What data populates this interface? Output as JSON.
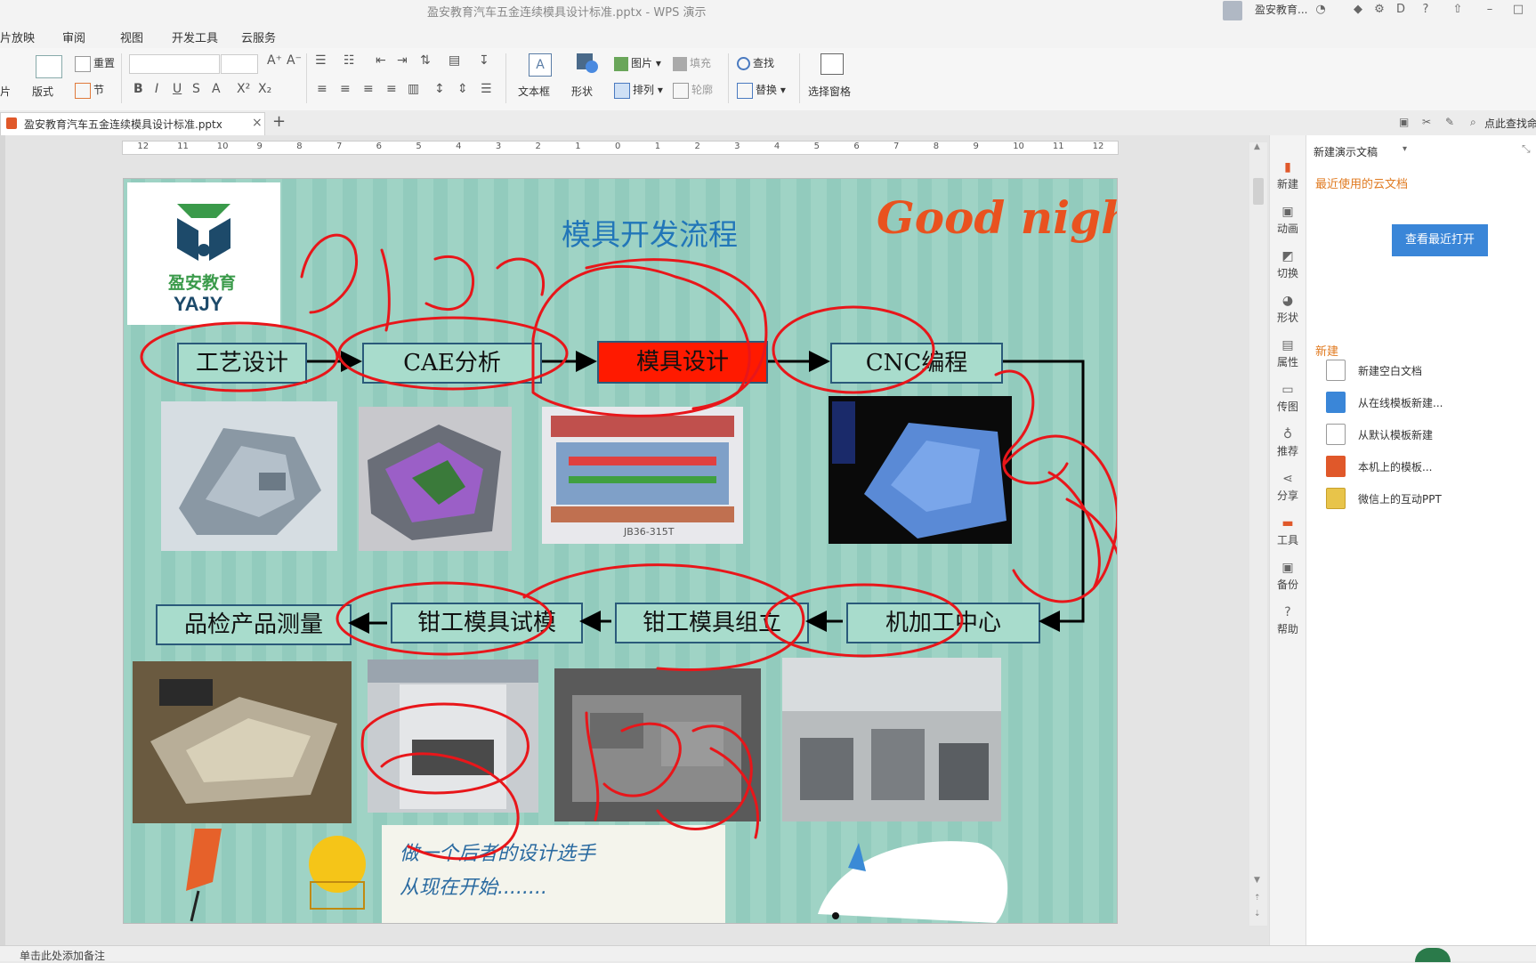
{
  "window": {
    "title": "盈安教育汽车五金连续模具设计标准.pptx - WPS 演示",
    "user": "盈安教育...",
    "help": "?"
  },
  "menu": [
    "片放映",
    "审阅",
    "视图",
    "开发工具",
    "云服务"
  ],
  "ribbon": {
    "slide_label": "片",
    "layout_label": "版式",
    "reset_label": "重置",
    "section_label": "节",
    "textbox_label": "文本框",
    "shape_label": "形状",
    "picture_label": "图片",
    "arrange_label": "排列",
    "fill_label": "填充",
    "outline_label": "轮廓",
    "find_label": "查找",
    "replace_label": "替换",
    "selection_pane_label": "选择窗格",
    "font_format": [
      "B",
      "I",
      "U",
      "S",
      "A",
      "X²",
      "X₂"
    ]
  },
  "tabs": {
    "doc_tab": "盈安教育汽车五金连续模具设计标准.pptx",
    "close": "×",
    "add": "+",
    "search_hint": "点此查找命"
  },
  "ruler": {
    "ticks": [
      "12",
      "11",
      "10",
      "9",
      "8",
      "7",
      "6",
      "5",
      "4",
      "3",
      "2",
      "1",
      "0",
      "1",
      "2",
      "3",
      "4",
      "5",
      "6",
      "7",
      "8",
      "9",
      "10",
      "11",
      "12"
    ]
  },
  "slide": {
    "logo_text_cn": "盈安教育",
    "logo_text_en": "YAJY",
    "title": "模具开发流程",
    "good_night": "Good night",
    "row1": [
      "工艺设计",
      "CAE分析",
      "模具设计",
      "CNC编程"
    ],
    "row2": [
      "品检产品测量",
      "钳工模具试模",
      "钳工模具组立",
      "机加工中心"
    ],
    "footer_line1": "做一个后者的设计选手",
    "footer_line2": "从现在开始........",
    "die_caption": "JB36-315T",
    "colors": {
      "background": "#9fd3c5",
      "title": "#2176b8",
      "highlight_box": "#ff1a00",
      "box_border": "#2a5a7a",
      "annotation": "#e8161a",
      "good_night": "#e9521f"
    }
  },
  "sidebar": {
    "items": [
      {
        "label": "新建",
        "icon": "new-doc-icon"
      },
      {
        "label": "动画",
        "icon": "animation-icon"
      },
      {
        "label": "切换",
        "icon": "transition-icon"
      },
      {
        "label": "形状",
        "icon": "shape-icon"
      },
      {
        "label": "属性",
        "icon": "properties-icon"
      },
      {
        "label": "传图",
        "icon": "upload-image-icon"
      },
      {
        "label": "推荐",
        "icon": "recommend-icon"
      },
      {
        "label": "分享",
        "icon": "share-icon"
      },
      {
        "label": "工具",
        "icon": "toolbox-icon"
      },
      {
        "label": "备份",
        "icon": "backup-icon"
      },
      {
        "label": "帮助",
        "icon": "help-icon"
      }
    ]
  },
  "panel": {
    "header": "新建演示文稿",
    "recent_cloud": "最近使用的云文档",
    "view_recent_button": "查看最近打开",
    "new_section": "新建",
    "links": [
      "新建空白文档",
      "从在线模板新建...",
      "从默认模板新建",
      "本机上的模板...",
      "微信上的互动PPT"
    ]
  },
  "status": {
    "notes_hint": "单击此处添加备注"
  }
}
